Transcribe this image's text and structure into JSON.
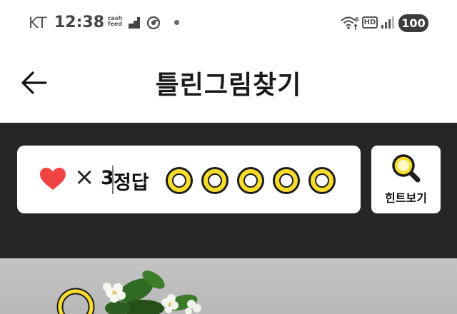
{
  "status_bar": {
    "carrier": "KT",
    "time": "12:38",
    "app_badge": "cash feed",
    "battery": "100"
  },
  "header": {
    "title": "틀린그림찾기"
  },
  "game": {
    "lives_count": "3",
    "answer_label": "정답",
    "answers_total": 5,
    "answers_found": 0,
    "slot_color": "#f7dc2e",
    "heart_color": "#f04444",
    "hint_label": "힌트보기"
  },
  "colors": {
    "dark_band": "#262626",
    "accent": "#f7dc2e"
  }
}
